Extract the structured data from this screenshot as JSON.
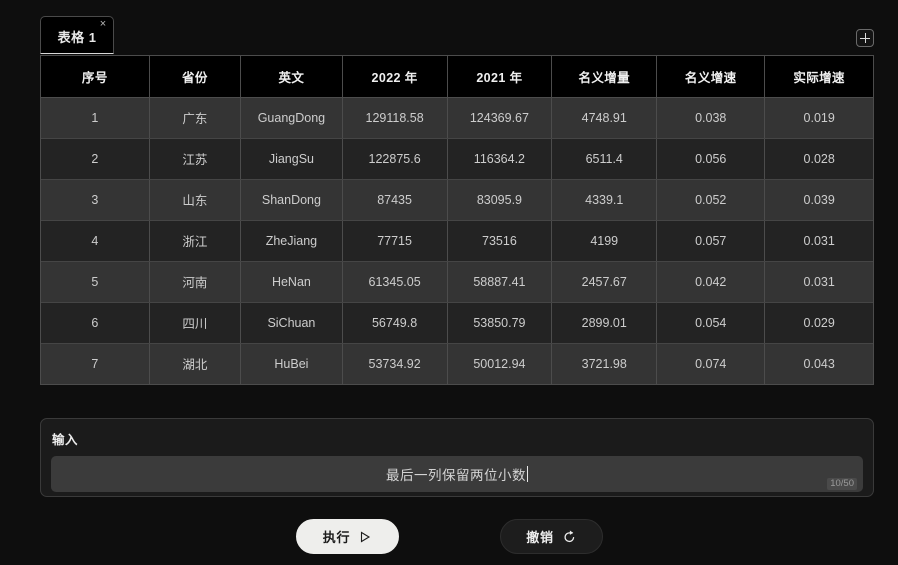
{
  "tabs": {
    "items": [
      {
        "label": "表格 1",
        "close_label": "×",
        "active": true
      }
    ],
    "add_label": "+"
  },
  "table": {
    "columns": [
      "序号",
      "省份",
      "英文",
      "2022 年",
      "2021 年",
      "名义增量",
      "名义增速",
      "实际增速"
    ],
    "rows": [
      [
        "1",
        "广东",
        "GuangDong",
        "129118.58",
        "124369.67",
        "4748.91",
        "0.038",
        "0.019"
      ],
      [
        "2",
        "江苏",
        "JiangSu",
        "122875.6",
        "116364.2",
        "6511.4",
        "0.056",
        "0.028"
      ],
      [
        "3",
        "山东",
        "ShanDong",
        "87435",
        "83095.9",
        "4339.1",
        "0.052",
        "0.039"
      ],
      [
        "4",
        "浙江",
        "ZheJiang",
        "77715",
        "73516",
        "4199",
        "0.057",
        "0.031"
      ],
      [
        "5",
        "河南",
        "HeNan",
        "61345.05",
        "58887.41",
        "2457.67",
        "0.042",
        "0.031"
      ],
      [
        "6",
        "四川",
        "SiChuan",
        "56749.8",
        "53850.79",
        "2899.01",
        "0.054",
        "0.029"
      ],
      [
        "7",
        "湖北",
        "HuBei",
        "53734.92",
        "50012.94",
        "3721.98",
        "0.074",
        "0.043"
      ]
    ]
  },
  "input": {
    "label": "输入",
    "value": "最后一列保留两位小数",
    "placeholder": "最后一列保留两位小数",
    "counter": "10/50",
    "max_length": 50
  },
  "actions": {
    "run_label": "执行",
    "run_icon": "play-triangle-icon",
    "undo_label": "撤销",
    "undo_icon": "undo-arrow-icon"
  },
  "colors": {
    "page_bg": "#0e0e0e",
    "header_bg": "#000000",
    "row_odd": "#343434",
    "row_even": "#232323",
    "border": "#4c4c4c",
    "run_button_bg": "#eeeeec",
    "undo_button_bg": "#1d1d1d",
    "text_primary": "#ececec",
    "text_secondary": "#cdcdcd"
  }
}
